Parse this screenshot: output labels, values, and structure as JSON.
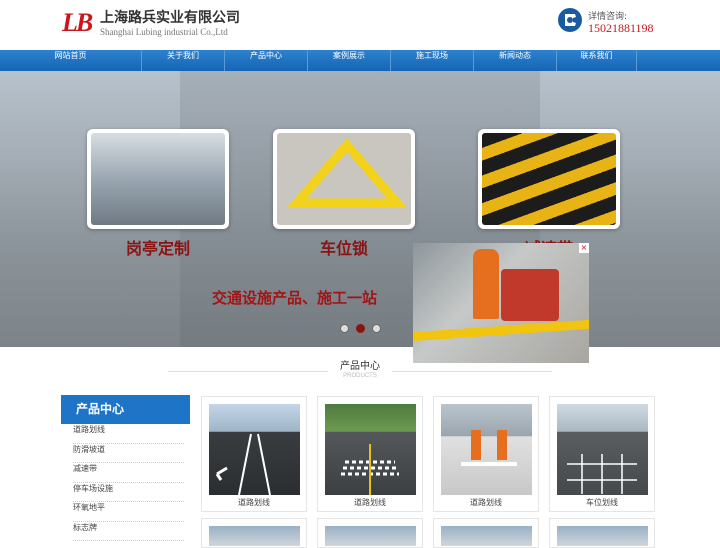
{
  "header": {
    "logo_text": "LB",
    "company_cn": "上海路兵实业有限公司",
    "company_en": "Shanghai Lubing industrial Co.,Ltd",
    "phone_label": "详情咨询:",
    "phone_number": "15021881198",
    "phone_icon": "phone-icon"
  },
  "nav": [
    "网站首页",
    "关于我们",
    "产品中心",
    "案例展示",
    "施工现场",
    "新闻动态",
    "联系我们"
  ],
  "banner": {
    "cards": [
      {
        "caption": "岗亭定制"
      },
      {
        "caption": "车位锁"
      },
      {
        "caption": "减速带"
      }
    ],
    "slogan": "交通设施产品、施工一站",
    "dots_total": 3,
    "dots_active_index": 1
  },
  "popup": {
    "close": "×"
  },
  "section": {
    "title": "产品中心",
    "subtitle": "PRODUCTS"
  },
  "sidebar": {
    "title": "产品中心",
    "items": [
      "道路划线",
      "防滑坡道",
      "减速带",
      "停车场设施",
      "环氧地平",
      "标志牌"
    ]
  },
  "products": [
    {
      "label": "道路划线"
    },
    {
      "label": "道路划线"
    },
    {
      "label": "道路划线"
    },
    {
      "label": "车位划线"
    }
  ],
  "colors": {
    "brand_red": "#c8161d",
    "nav_blue": "#1565b5",
    "caption_red": "#8a1414"
  }
}
